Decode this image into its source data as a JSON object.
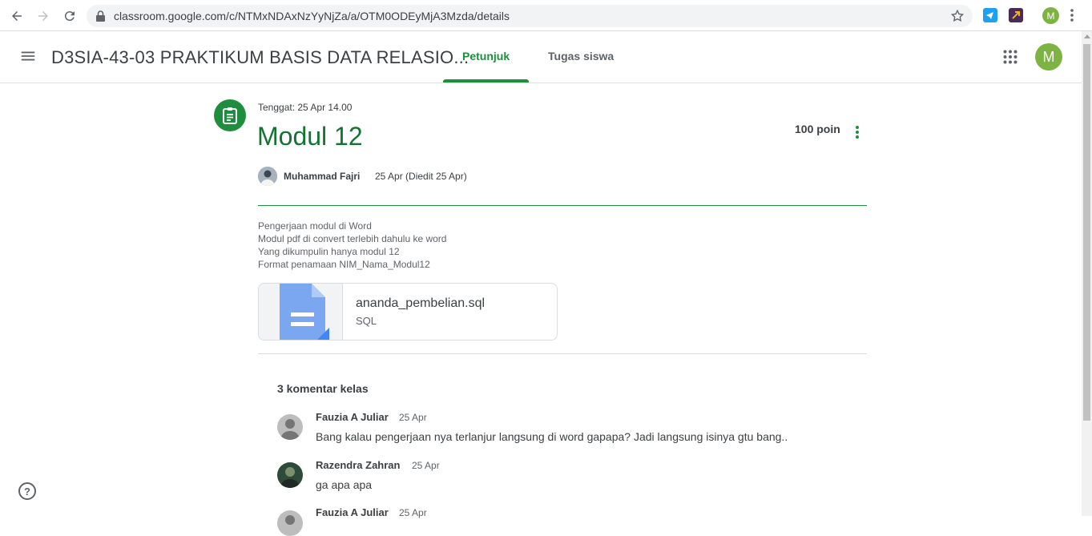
{
  "browser": {
    "url": "classroom.google.com/c/NTMxNDAxNzYyNjZa/a/OTM0ODEyMjA3Mzda/details",
    "profile_initial": "M"
  },
  "header": {
    "course_title": "D3SIA-43-03 PRAKTIKUM BASIS DATA RELASIO...",
    "tabs": [
      {
        "label": "Petunjuk",
        "active": true
      },
      {
        "label": "Tugas siswa",
        "active": false
      }
    ],
    "avatar_initial": "M"
  },
  "assignment": {
    "due": "Tenggat: 25 Apr 14.00",
    "title": "Modul 12",
    "points": "100 poin",
    "author": "Muhammad Fajri",
    "posted": "25 Apr (Diedit 25 Apr)",
    "description": [
      "Pengerjaan modul di Word",
      "Modul pdf di convert terlebih dahulu ke word",
      "Yang dikumpulin hanya modul 12",
      "Format penamaan NIM_Nama_Modul12"
    ],
    "attachment": {
      "name": "ananda_pembelian.sql",
      "type": "SQL"
    }
  },
  "comments": {
    "heading": "3 komentar kelas",
    "items": [
      {
        "name": "Fauzia A Juliar",
        "date": "25 Apr",
        "text": "Bang kalau pengerjaan nya terlanjur langsung di word gapapa? Jadi langsung isinya gtu bang.."
      },
      {
        "name": "Razendra Zahran",
        "date": "25 Apr",
        "text": "ga apa apa"
      },
      {
        "name": "Fauzia A Juliar",
        "date": "25 Apr",
        "text": ""
      }
    ]
  },
  "colors": {
    "accent": "#1e8e3e",
    "title": "#137333",
    "profile": "#7cb342"
  },
  "help_label": "?"
}
